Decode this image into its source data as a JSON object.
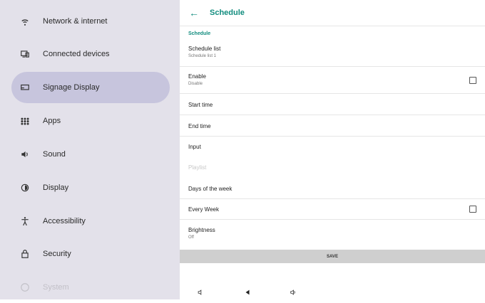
{
  "sidebar": {
    "items": [
      {
        "label": "Network & internet",
        "icon": "wifi-icon"
      },
      {
        "label": "Connected devices",
        "icon": "devices-icon"
      },
      {
        "label": "Signage Display",
        "icon": "display-icon"
      },
      {
        "label": "Apps",
        "icon": "apps-grid-icon"
      },
      {
        "label": "Sound",
        "icon": "volume-icon"
      },
      {
        "label": "Display",
        "icon": "brightness-icon"
      },
      {
        "label": "Accessibility",
        "icon": "accessibility-icon"
      },
      {
        "label": "Security",
        "icon": "lock-icon"
      },
      {
        "label": "System",
        "icon": "info-icon"
      }
    ]
  },
  "header": {
    "back_icon": "←",
    "title": "Schedule"
  },
  "section": {
    "label": "Schedule"
  },
  "rows": {
    "schedule_list": {
      "title": "Schedule list",
      "sub": "Schedule list 1"
    },
    "enable": {
      "title": "Enable",
      "sub": "Disable",
      "checked": false
    },
    "start_time": {
      "title": "Start time"
    },
    "end_time": {
      "title": "End time"
    },
    "input": {
      "title": "Input"
    },
    "playlist": {
      "title": "Playlist",
      "disabled": true
    },
    "days_of_week": {
      "title": "Days of the week"
    },
    "every_week": {
      "title": "Every Week",
      "checked": false
    },
    "brightness": {
      "title": "Brightness",
      "sub": "Off"
    }
  },
  "save": {
    "label": "SAVE"
  },
  "colors": {
    "accent": "#118c7e",
    "sidebar_bg": "#e3e1ea",
    "sidebar_active": "#c7c5dd",
    "save_bg": "#cfcfcf"
  }
}
